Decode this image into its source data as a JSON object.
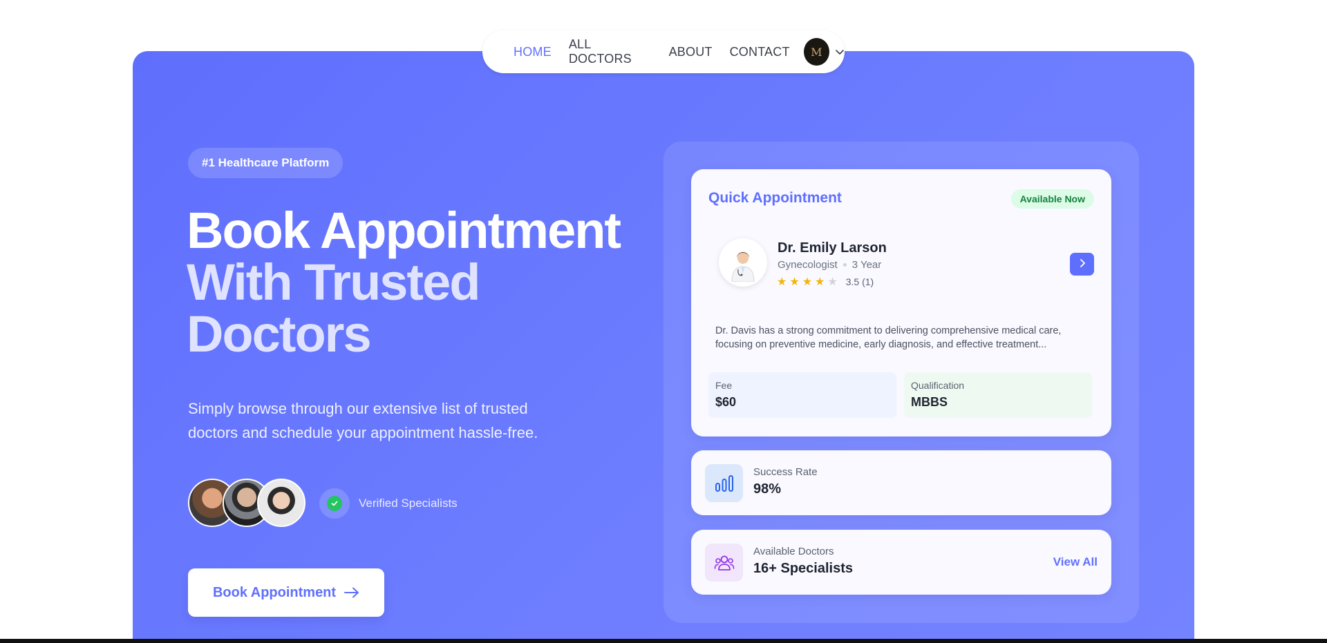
{
  "nav": {
    "items": [
      {
        "label": "HOME",
        "active": true
      },
      {
        "label": "ALL DOCTORS",
        "active": false
      },
      {
        "label": "ABOUT",
        "active": false
      },
      {
        "label": "CONTACT",
        "active": false
      }
    ],
    "avatar_letter": "M"
  },
  "hero": {
    "badge": "#1 Healthcare Platform",
    "headline": [
      "Book Appointment",
      "With Trusted",
      "Doctors"
    ],
    "subtitle_lines": [
      "Simply browse through our extensive list of trusted",
      "doctors and schedule your appointment hassle-free."
    ],
    "verified_label": "Verified Specialists",
    "cta_label": "Book Appointment"
  },
  "quick_appointment": {
    "title": "Quick Appointment",
    "status_badge": "Available Now",
    "doctor": {
      "name": "Dr. Emily Larson",
      "specialty": "Gynecologist",
      "experience": "3 Year",
      "rating_stars": 4,
      "rating_text": "3.5 (1)",
      "description_lines": [
        "Dr. Davis has a strong commitment to delivering comprehensive medical care,",
        "focusing on preventive medicine, early diagnosis, and effective treatment..."
      ]
    },
    "fee": {
      "label": "Fee",
      "value": "$60"
    },
    "qualification": {
      "label": "Qualification",
      "value": "MBBS"
    }
  },
  "success_rate": {
    "label": "Success Rate",
    "value": "98%",
    "icon": "bar-chart-icon"
  },
  "available_doctors": {
    "label": "Available Doctors",
    "value": "16+ Specialists",
    "link": "View All",
    "icon": "users-icon"
  },
  "colors": {
    "brand": "#5f6ffd",
    "success": "#22c55e",
    "star": "#f5b400"
  }
}
